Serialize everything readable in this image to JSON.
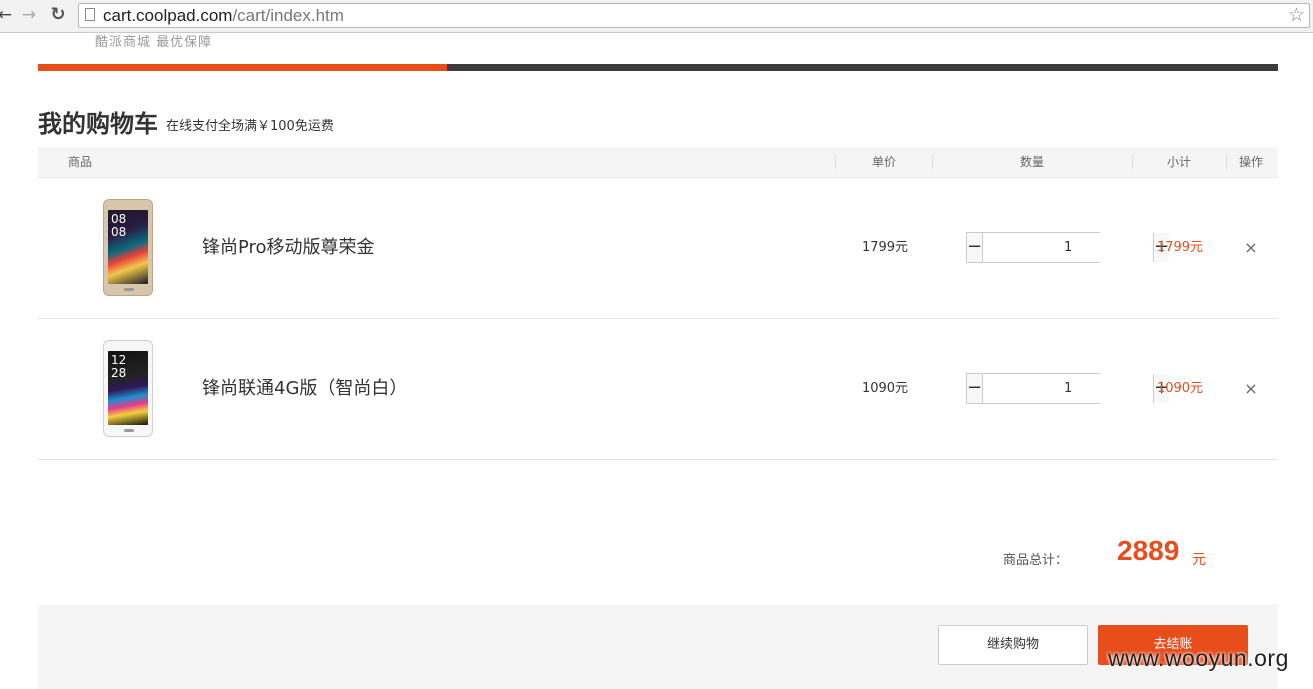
{
  "browser": {
    "url_host": "cart.coolpad.com",
    "url_path": "/cart/index.htm"
  },
  "site": {
    "slogan": "酷派商城  最优保障",
    "steps_progress_percent": 33
  },
  "cart": {
    "title": "我的购物车",
    "note": "在线支付全场满￥100免运费",
    "columns": {
      "product": "商品",
      "unit_price": "单价",
      "quantity": "数量",
      "subtotal": "小计",
      "action": "操作"
    },
    "items": [
      {
        "name": "锋尚Pro移动版尊荣金",
        "unit_price": "1799元",
        "quantity": "1",
        "subtotal": "1799元",
        "image_clock": "08\n08",
        "remove": "×",
        "minus": "−",
        "plus": "+"
      },
      {
        "name": "锋尚联通4G版（智尚白）",
        "unit_price": "1090元",
        "quantity": "1",
        "subtotal": "1090元",
        "image_clock": "12\n28",
        "remove": "×",
        "minus": "−",
        "plus": "+"
      }
    ],
    "total_label": "商品总计：",
    "total_amount": "2889",
    "total_unit": "元",
    "continue_label": "继续购物",
    "checkout_label": "去结账"
  },
  "watermark": "www.wooyun.org",
  "colors": {
    "accent": "#e84d1c",
    "dark_bar": "#3c3c3c"
  }
}
